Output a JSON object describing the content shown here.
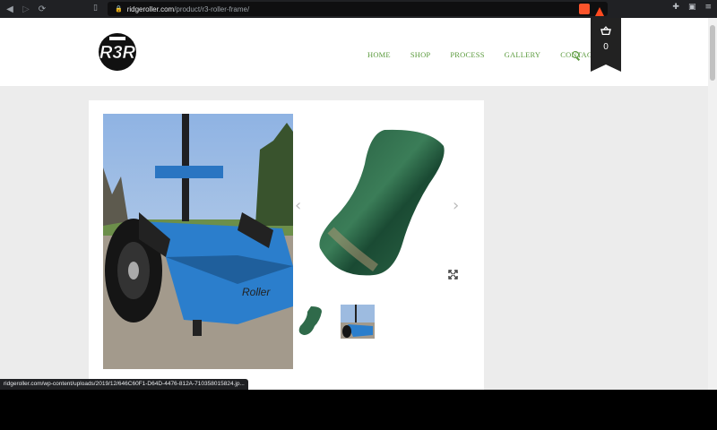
{
  "browser": {
    "url_host": "ridgeroller.com",
    "url_path": "/product/r3-roller-frame/",
    "status_url": "ridgeroller.com/wp-content/uploads/2019/12/646C60F1-D64D-4476-812A-710358015824.jp..."
  },
  "site": {
    "logo_text": "R3",
    "nav": [
      "HOME",
      "SHOP",
      "PROCESS",
      "GALLERY",
      "CONTACT US"
    ],
    "cart_count": "0",
    "accent_color": "#5a9a3c"
  },
  "product": {
    "main_image": "blue disc golf cart photo",
    "swatch_image": "green metallic powder coat swatch",
    "thumbnails": [
      "green swatch",
      "blue cart photo"
    ]
  }
}
